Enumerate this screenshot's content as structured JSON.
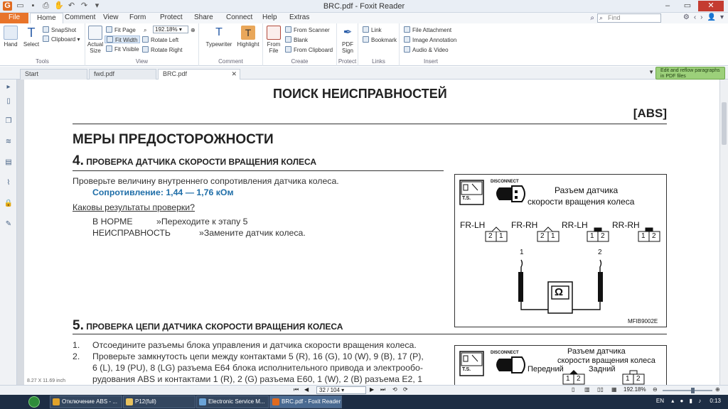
{
  "window": {
    "title": "BRC.pdf - Foxit Reader"
  },
  "menu": {
    "file": "File",
    "tabs": [
      "Home",
      "Comment",
      "View",
      "Form",
      "Protect",
      "Share",
      "Connect",
      "Help",
      "Extras"
    ],
    "search_placeholder": "Find"
  },
  "ribbon": {
    "tools": {
      "hand": "Hand",
      "select": "Select",
      "snapshot": "SnapShot",
      "clipboard": "Clipboard",
      "label": "Tools"
    },
    "view": {
      "actual_size": "Actual Size",
      "fit_page": "Fit Page",
      "fit_width": "Fit Width",
      "fit_visible": "Fit Visible",
      "zoom": "192.18%",
      "rotate_left": "Rotate Left",
      "rotate_right": "Rotate Right",
      "label": "View"
    },
    "comment": {
      "typewriter": "Typewriter",
      "highlight": "Highlight",
      "label": "Comment"
    },
    "create": {
      "from_file": "From File",
      "from_scanner": "From Scanner",
      "blank": "Blank",
      "from_clipboard": "From Clipboard",
      "label": "Create"
    },
    "protect": {
      "pdf_sign": "PDF Sign",
      "label": "Protect"
    },
    "links": {
      "link": "Link",
      "bookmark": "Bookmark",
      "label": "Links"
    },
    "insert": {
      "file_attachment": "File Attachment",
      "image_annotation": "Image Annotation",
      "audio_video": "Audio & Video",
      "label": "Insert"
    }
  },
  "tabs": {
    "items": [
      "Start",
      "fwd.pdf",
      "BRC.pdf"
    ],
    "reflow": "Edit and reflow paragraphs in PDF files"
  },
  "document": {
    "header": "ПОИСК НЕИСПРАВНОСТЕЙ",
    "tag": "[ABS]",
    "section_title": "МЕРЫ ПРЕДОСТОРОЖНОСТИ",
    "step4": {
      "num": "4.",
      "title": "ПРОВЕРКА ДАТЧИКА СКОРОСТИ ВРАЩЕНИЯ КОЛЕСА"
    },
    "check_text": "Проверьте величину внутреннего сопротивления датчика колеса.",
    "resistance": "Сопротивление: 1,44 — 1,76 кОм",
    "question": "Каковы результаты проверки?",
    "ok_label": "В НОРМЕ",
    "ok_action": "»Переходите к этапу 5",
    "ng_label": "НЕИСПРАВНОСТЬ",
    "ng_action": "»Замените датчик колеса.",
    "step5": {
      "num": "5.",
      "title": "ПРОВЕРКА ЦЕПИ ДАТЧИКА СКОРОСТИ ВРАЩЕНИЯ КОЛЕСА"
    },
    "items": [
      {
        "n": "1.",
        "lines": [
          "Отсоедините разъемы блока управления и датчика скорости вращения колеса."
        ]
      },
      {
        "n": "2.",
        "lines": [
          "Проверьте замкнутость цепи между контактами 5 (R), 16 (G), 10 (W), 9 (B), 17 (P),",
          "6 (L), 19 (PU), 8 (LG) разъема E64 блока исполнительного привода и электрообо-",
          "рудования ABS и контактами 1 (R), 2 (G) разъема E60, 1 (W), 2 (B) разъема E2, 1"
        ]
      }
    ],
    "figure1": {
      "disconnect": "DISCONNECT",
      "ts": "T.S.",
      "caption_l1": "Разъем датчика",
      "caption_l2": "скорости вращения колеса",
      "labels": [
        "FR-LH",
        "FR-RH",
        "RR-LH",
        "RR-RH"
      ],
      "pins": [
        [
          "2",
          "1"
        ],
        [
          "2",
          "1"
        ],
        [
          "1",
          "2"
        ],
        [
          "1",
          "2"
        ]
      ],
      "probe1": "1",
      "probe2": "2",
      "meter": "Ω",
      "code": "MFIB9002E"
    },
    "figure2": {
      "disconnect": "DISCONNECT",
      "ts": "T.S.",
      "caption_l1": "Разъем датчика",
      "caption_l2": "скорости вращения колеса",
      "front": "Передний",
      "rear": "Задний",
      "pins_front": [
        "1",
        "2"
      ],
      "pins_rear": [
        "1",
        "2"
      ]
    }
  },
  "status": {
    "page_size": "8.27 X 11.69 inch",
    "page": "32 / 104",
    "zoom": "192.18%"
  },
  "taskbar": {
    "items": [
      "Отключение ABS - ...",
      "P12(full)",
      "Electronic Service M...",
      "BRC.pdf - Foxit Reader"
    ],
    "lang": "EN",
    "time": "0:13"
  }
}
